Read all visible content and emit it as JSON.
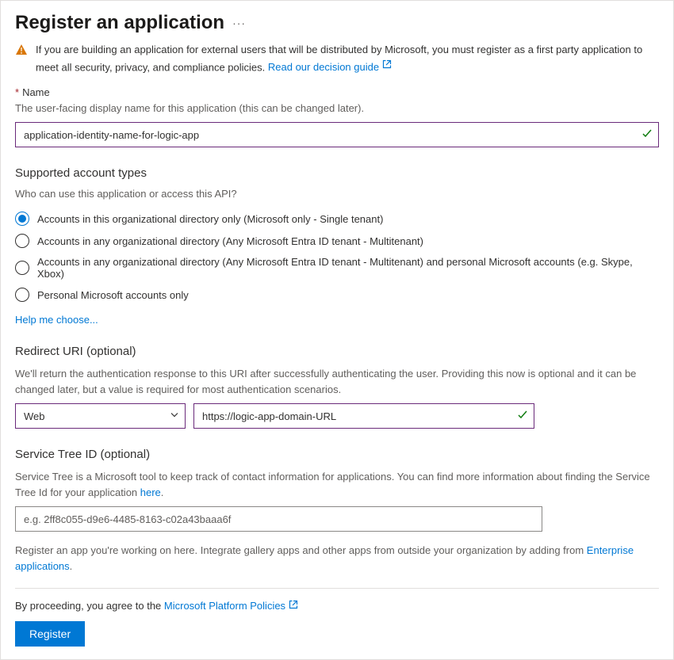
{
  "header": {
    "title": "Register an application"
  },
  "warning": {
    "text": "If you are building an application for external users that will be distributed by Microsoft, you must register as a first party application to meet all security, privacy, and compliance policies. ",
    "link_text": "Read our decision guide"
  },
  "name_field": {
    "label": "Name",
    "help": "The user-facing display name for this application (this can be changed later).",
    "value": "application-identity-name-for-logic-app"
  },
  "account_types": {
    "heading": "Supported account types",
    "subtitle": "Who can use this application or access this API?",
    "options": [
      "Accounts in this organizational directory only (Microsoft only - Single tenant)",
      "Accounts in any organizational directory (Any Microsoft Entra ID tenant - Multitenant)",
      "Accounts in any organizational directory (Any Microsoft Entra ID tenant - Multitenant) and personal Microsoft accounts (e.g. Skype, Xbox)",
      "Personal Microsoft accounts only"
    ],
    "selected_index": 0,
    "help_link": "Help me choose..."
  },
  "redirect_uri": {
    "heading": "Redirect URI (optional)",
    "help": "We'll return the authentication response to this URI after successfully authenticating the user. Providing this now is optional and it can be changed later, but a value is required for most authentication scenarios.",
    "platform_selected": "Web",
    "uri_value": "https://logic-app-domain-URL"
  },
  "service_tree": {
    "heading": "Service Tree ID (optional)",
    "help_prefix": "Service Tree is a Microsoft tool to keep track of contact information for applications. You can find more information about finding the Service Tree Id for your application ",
    "help_link": "here",
    "help_suffix": ".",
    "placeholder": "e.g. 2ff8c055-d9e6-4485-8163-c02a43baaa6f"
  },
  "footer_note": {
    "prefix": "Register an app you're working on here. Integrate gallery apps and other apps from outside your organization by adding from ",
    "link": "Enterprise applications",
    "suffix": "."
  },
  "agree": {
    "prefix": "By proceeding, you agree to the ",
    "link": "Microsoft Platform Policies"
  },
  "register_button": "Register"
}
